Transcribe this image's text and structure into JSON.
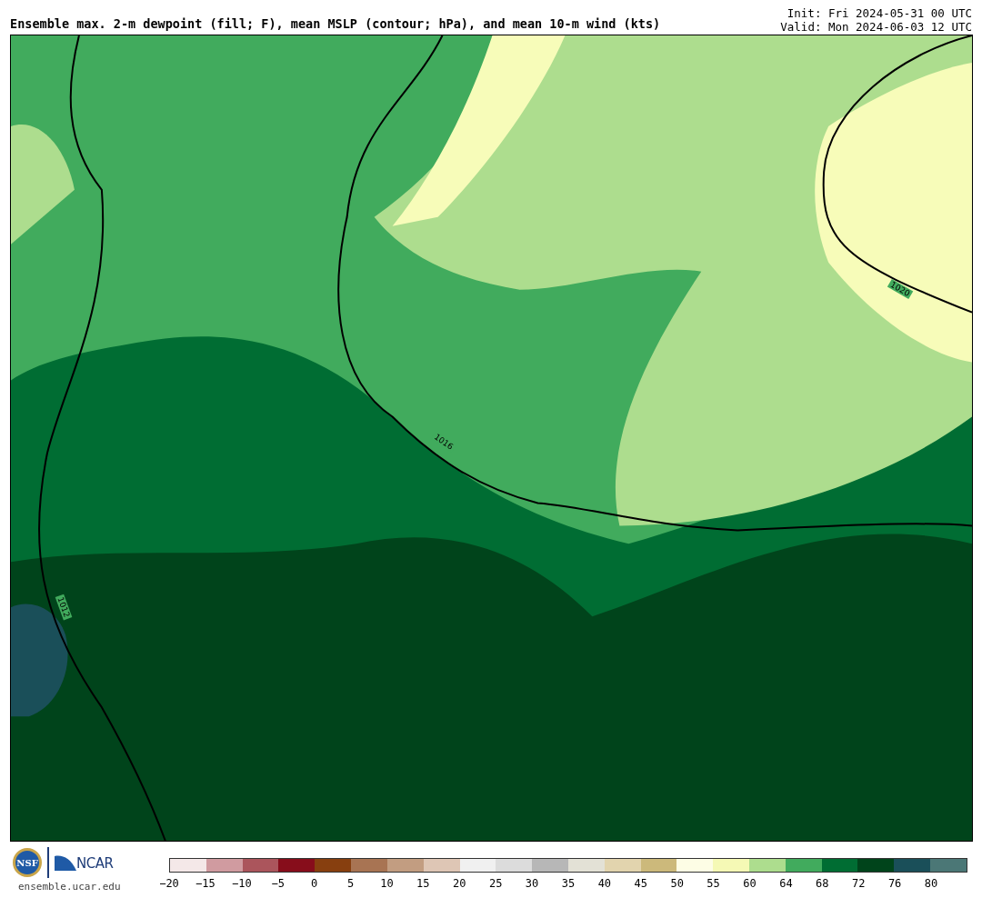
{
  "title": "Ensemble max. 2-m dewpoint (fill; F), mean MSLP (contour; hPa), and mean 10-m wind (kts)",
  "init": "Init: Fri 2024-05-31 00 UTC",
  "valid": "Valid: Mon 2024-06-03 12 UTC",
  "map": {
    "contour_labels": [
      "1020",
      "1016",
      "1012"
    ]
  },
  "logos": {
    "nsf": "NSF",
    "ncar": "NCAR",
    "url": "ensemble.ucar.edu"
  },
  "colorbar": {
    "segments": [
      {
        "color": "#f4e8e8"
      },
      {
        "color": "#d09ba0"
      },
      {
        "color": "#ab555c"
      },
      {
        "color": "#870d1b"
      },
      {
        "color": "#873f0f"
      },
      {
        "color": "#a87453"
      },
      {
        "color": "#c29d81"
      },
      {
        "color": "#dec6b5"
      },
      {
        "color": "#f0f0f0"
      },
      {
        "color": "#dcdcdc"
      },
      {
        "color": "#b7b7b7"
      },
      {
        "color": "#e3e1d6"
      },
      {
        "color": "#e2d4ae"
      },
      {
        "color": "#ccb97b"
      },
      {
        "color": "#fdfde5"
      },
      {
        "color": "#f5f9b5"
      },
      {
        "color": "#addd8e"
      },
      {
        "color": "#41ab5d"
      },
      {
        "color": "#006d33"
      },
      {
        "color": "#00441b"
      },
      {
        "color": "#1a4f59"
      },
      {
        "color": "#4b7776"
      }
    ],
    "ticks": [
      "−20",
      "−15",
      "−10",
      "−5",
      "0",
      "5",
      "10",
      "15",
      "20",
      "25",
      "30",
      "35",
      "40",
      "45",
      "50",
      "55",
      "60",
      "64",
      "68",
      "72",
      "76",
      "80"
    ]
  }
}
